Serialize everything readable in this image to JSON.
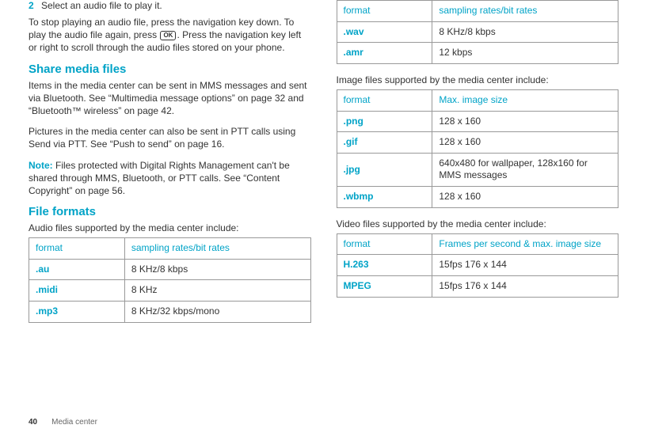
{
  "left": {
    "step_number": "2",
    "step_text": "Select an audio file to play it.",
    "stop_para_a": "To stop playing an audio file, press the navigation key down. To play the audio file again, press ",
    "ok_label": "OK",
    "stop_para_b": ". Press the navigation key left or right to scroll through the audio files stored on your phone.",
    "share_heading": "Share media files",
    "share_p1": "Items in the media center can be sent in MMS messages and sent via Bluetooth. See “Multimedia message options” on page 32 and “Bluetooth™ wireless” on page 42.",
    "share_p2": "Pictures in the media center can also be sent in PTT calls using Send via PTT. See “Push to send” on page 16.",
    "note_label": "Note:",
    "note_text": " Files protected with Digital Rights Management can't be shared through MMS, Bluetooth, or PTT calls. See “Content Copyright” on page 56.",
    "formats_heading": "File formats",
    "audio_intro": "Audio files supported by the media center include:",
    "audio_table": {
      "head1": "format",
      "head2": "sampling rates/bit rates",
      "rows": [
        {
          "c1": ".au",
          "c2": "8 KHz/8 kbps"
        },
        {
          "c1": ".midi",
          "c2": "8 KHz"
        },
        {
          "c1": ".mp3",
          "c2": "8 KHz/32 kbps/mono"
        }
      ]
    }
  },
  "right": {
    "audio_cont": {
      "head1": "format",
      "head2": "sampling rates/bit rates",
      "rows": [
        {
          "c1": ".wav",
          "c2": "8 KHz/8 kbps"
        },
        {
          "c1": ".amr",
          "c2": "12 kbps"
        }
      ]
    },
    "image_intro": "Image files supported by the media center include:",
    "image_table": {
      "head1": "format",
      "head2": "Max. image size",
      "rows": [
        {
          "c1": ".png",
          "c2": "128 x 160"
        },
        {
          "c1": ".gif",
          "c2": "128 x 160"
        },
        {
          "c1": ".jpg",
          "c2": "640x480 for wallpaper, 128x160 for MMS messages"
        },
        {
          "c1": ".wbmp",
          "c2": "128 x 160"
        }
      ]
    },
    "video_intro": "Video files supported by the media center include:",
    "video_table": {
      "head1": "format",
      "head2": "Frames per second & max. image size",
      "rows": [
        {
          "c1": "H.263",
          "c2": "15fps 176 x 144"
        },
        {
          "c1": "MPEG",
          "c2": "15fps 176 x 144"
        }
      ]
    }
  },
  "footer": {
    "page": "40",
    "section": "Media center"
  },
  "chart_data": [
    {
      "type": "table",
      "title": "Audio files supported",
      "columns": [
        "format",
        "sampling rates/bit rates"
      ],
      "rows": [
        [
          ".au",
          "8 KHz/8 kbps"
        ],
        [
          ".midi",
          "8 KHz"
        ],
        [
          ".mp3",
          "8 KHz/32 kbps/mono"
        ],
        [
          ".wav",
          "8 KHz/8 kbps"
        ],
        [
          ".amr",
          "12 kbps"
        ]
      ]
    },
    {
      "type": "table",
      "title": "Image files supported",
      "columns": [
        "format",
        "Max. image size"
      ],
      "rows": [
        [
          ".png",
          "128 x 160"
        ],
        [
          ".gif",
          "128 x 160"
        ],
        [
          ".jpg",
          "640x480 for wallpaper, 128x160 for MMS messages"
        ],
        [
          ".wbmp",
          "128 x 160"
        ]
      ]
    },
    {
      "type": "table",
      "title": "Video files supported",
      "columns": [
        "format",
        "Frames per second & max. image size"
      ],
      "rows": [
        [
          "H.263",
          "15fps 176 x 144"
        ],
        [
          "MPEG",
          "15fps 176 x 144"
        ]
      ]
    }
  ]
}
